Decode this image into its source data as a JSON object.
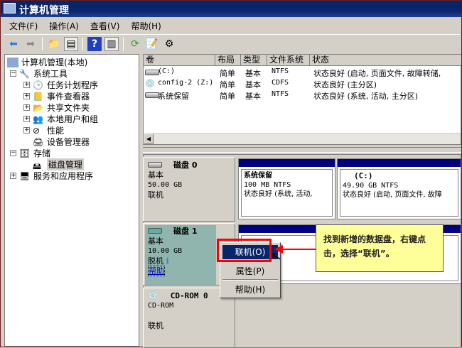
{
  "window": {
    "title": "计算机管理"
  },
  "menu": [
    "文件(F)",
    "操作(A)",
    "查看(V)",
    "帮助(H)"
  ],
  "toolbar": [
    "back-icon",
    "forward-icon",
    "up-folder-icon",
    "show-hide-tree-icon",
    "help-icon",
    "action-pane-icon",
    "refresh-icon",
    "properties-icon",
    "settings-icon"
  ],
  "tree": {
    "root": "计算机管理(本地)",
    "system_tools": "系统工具",
    "task_scheduler": "任务计划程序",
    "event_viewer": "事件查看器",
    "shared_folders": "共享文件夹",
    "local_users": "本地用户和组",
    "performance": "性能",
    "device_manager": "设备管理器",
    "storage": "存储",
    "disk_management": "磁盘管理",
    "services_apps": "服务和应用程序"
  },
  "volumes": {
    "columns": [
      "卷",
      "布局",
      "类型",
      "文件系统",
      "状态"
    ],
    "rows": [
      {
        "name": " (C:)",
        "layout": "简单",
        "type": "基本",
        "fs": "NTFS",
        "status": "状态良好 (启动, 页面文件, 故障转储,"
      },
      {
        "name": "config-2 (Z:)",
        "layout": "简单",
        "type": "基本",
        "fs": "CDFS",
        "status": "状态良好 (主分区)"
      },
      {
        "name": "系统保留",
        "layout": "简单",
        "type": "基本",
        "fs": "NTFS",
        "status": "状态良好 (系统, 活动, 主分区)"
      }
    ]
  },
  "disks": [
    {
      "name": "磁盘 0",
      "type": "基本",
      "size": "50.00 GB",
      "state": "联机",
      "partitions": [
        {
          "name": "系统保留",
          "info": "100 MB NTFS",
          "status": "状态良好 (系统, 活动,"
        },
        {
          "name": "(C:)",
          "info": "49.90 GB NTFS",
          "status": "状态良好 (启动, 页面文件, 故障"
        }
      ]
    },
    {
      "name": "磁盘 1",
      "type": "基本",
      "size": "10.00 GB",
      "state": "脱机",
      "help": "帮助"
    },
    {
      "name": "CD-ROM 0",
      "type": "CD-ROM",
      "state": "联机"
    }
  ],
  "context_menu": [
    "联机(O)",
    "属性(P)",
    "帮助(H)"
  ],
  "callout": "找到新增的数据盘，右键点击，选择“联机”。",
  "colors": {
    "title_bar": "#0a246a",
    "partition_bar": "#000080",
    "highlight": "#ff0000",
    "callout_bg": "#ffff99",
    "selected_disk": "#8fb5ae"
  }
}
